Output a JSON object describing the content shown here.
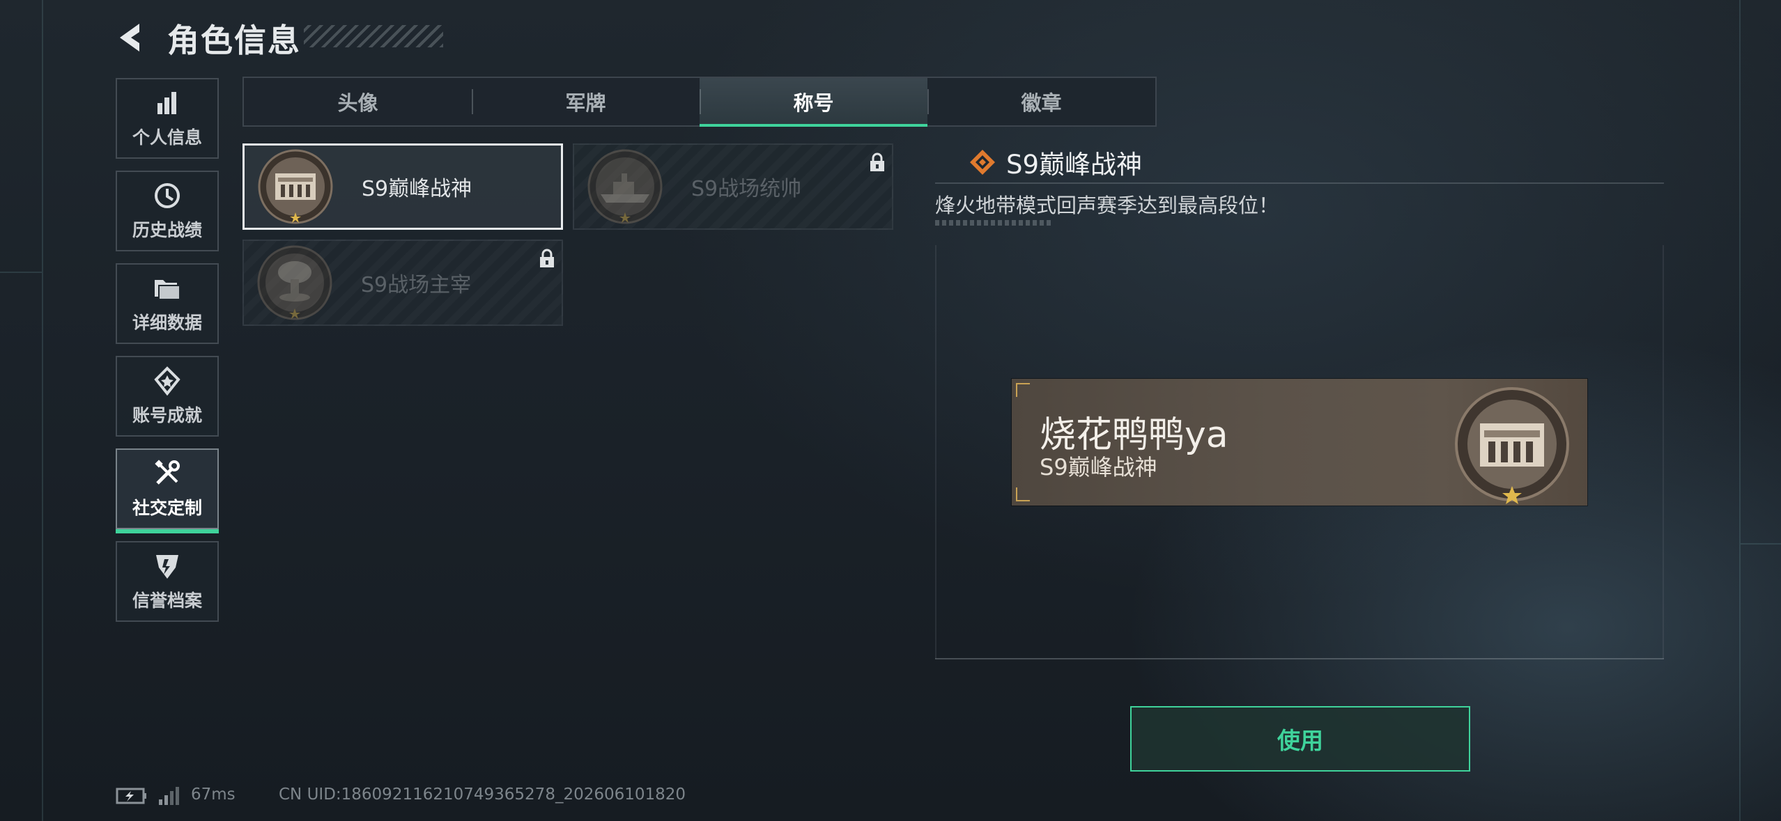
{
  "header": {
    "title": "角色信息"
  },
  "sidebar": {
    "items": [
      {
        "label": "个人信息",
        "icon": "bar-chart-icon"
      },
      {
        "label": "历史战绩",
        "icon": "history-clock-icon"
      },
      {
        "label": "详细数据",
        "icon": "folder-icon"
      },
      {
        "label": "账号成就",
        "icon": "achievement-badge-icon"
      },
      {
        "label": "社交定制",
        "icon": "tools-icon",
        "active": true
      },
      {
        "label": "信誉档案",
        "icon": "credit-shield-icon"
      }
    ]
  },
  "tabs": [
    {
      "label": "头像"
    },
    {
      "label": "军牌"
    },
    {
      "label": "称号",
      "active": true
    },
    {
      "label": "徽章"
    }
  ],
  "titles": [
    {
      "name": "S9巅峰战神",
      "selected": true,
      "locked": false,
      "emblem": "fortress-emblem"
    },
    {
      "name": "S9战场统帅",
      "selected": false,
      "locked": true,
      "emblem": "warship-emblem"
    },
    {
      "name": "S9战场主宰",
      "selected": false,
      "locked": true,
      "emblem": "mushroom-cloud-emblem"
    }
  ],
  "detail": {
    "title": "S9巅峰战神",
    "description": "烽火地带模式回声赛季达到最高段位！"
  },
  "preview": {
    "player_name": "烧花鸭鸭ya",
    "title": "S9巅峰战神"
  },
  "actions": {
    "use_label": "使用"
  },
  "status": {
    "ping": "67ms",
    "uid": "CN UID:18609211621074936527​8_202606101820"
  },
  "colors": {
    "accent": "#3fd39b",
    "gold": "#c9a254",
    "plate": "#5b5249"
  }
}
